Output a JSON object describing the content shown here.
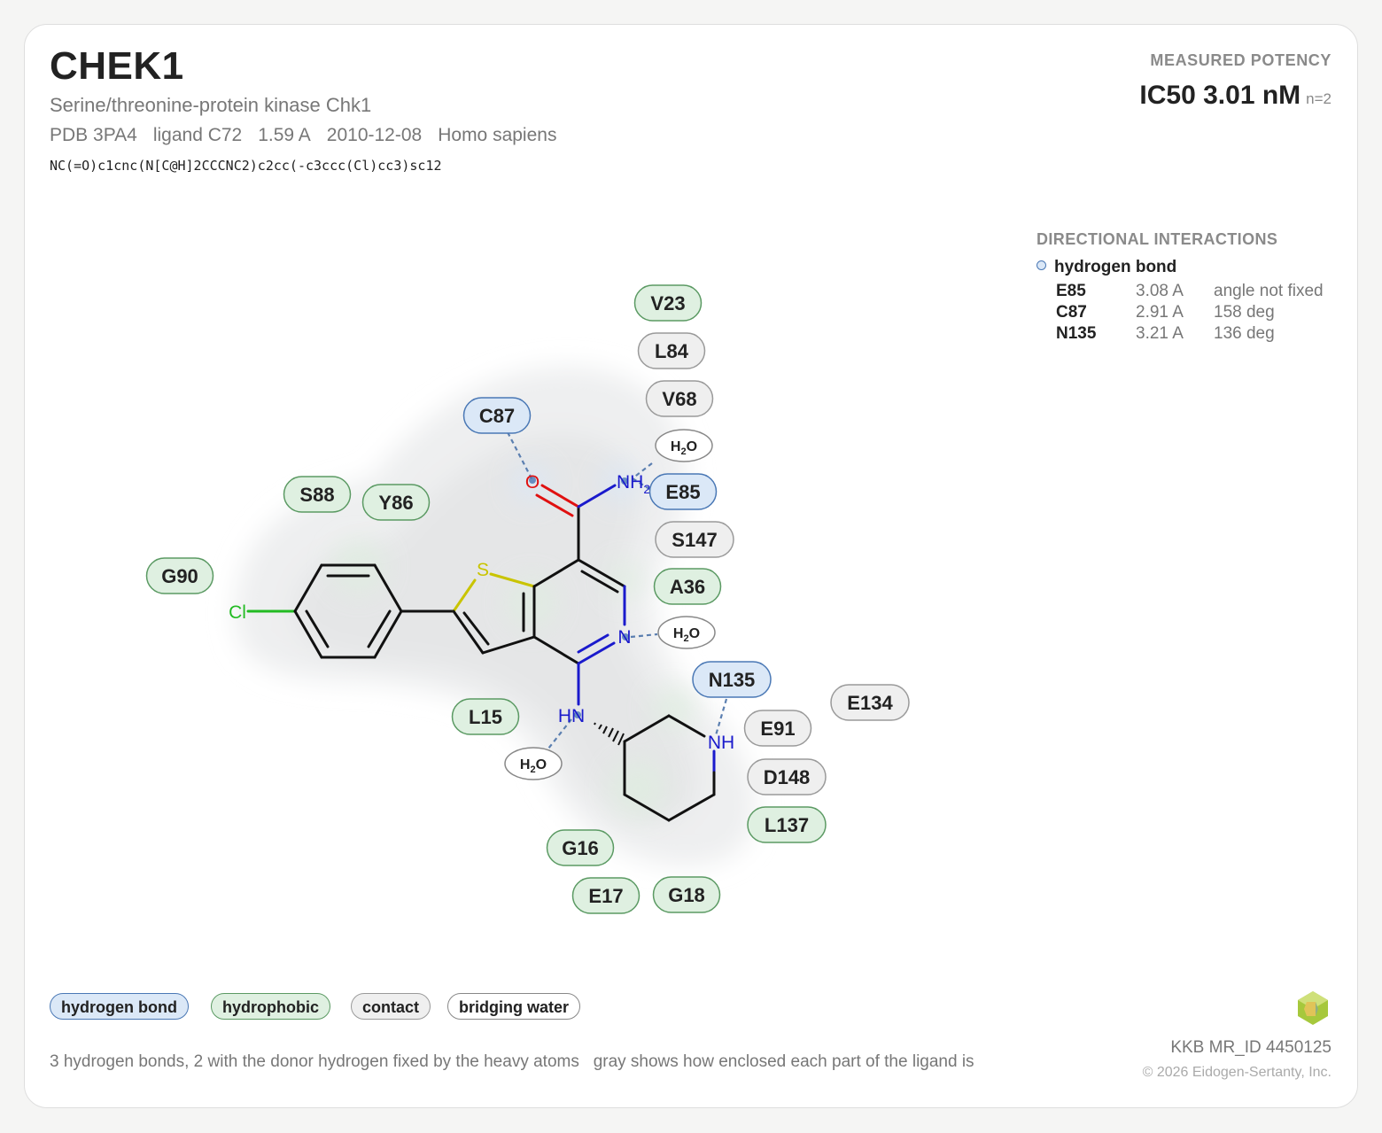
{
  "header": {
    "gene": "CHEK1",
    "protein": "Serine/threonine-protein kinase Chk1",
    "pdb": "PDB 3PA4",
    "ligand": "ligand C72",
    "resolution": "1.59 A",
    "date": "2010-12-08",
    "organism": "Homo sapiens",
    "smiles": "NC(=O)c1cnc(N[C@H]2CCCNC2)c2cc(-c3ccc(Cl)cc3)sc12"
  },
  "potency": {
    "label": "MEASURED POTENCY",
    "value": "IC50 3.01 nM",
    "n": "n=2"
  },
  "directional_interactions": {
    "title": "DIRECTIONAL INTERACTIONS",
    "type": "hydrogen bond",
    "rows": [
      {
        "residue": "E85",
        "distance": "3.08 A",
        "angle": "angle not fixed"
      },
      {
        "residue": "C87",
        "distance": "2.91 A",
        "angle": "158 deg"
      },
      {
        "residue": "N135",
        "distance": "3.21 A",
        "angle": "136 deg"
      }
    ]
  },
  "residues": [
    {
      "label": "V23",
      "kind": "hydrophobic"
    },
    {
      "label": "L84",
      "kind": "contact"
    },
    {
      "label": "V68",
      "kind": "contact"
    },
    {
      "label": "C87",
      "kind": "hbond"
    },
    {
      "label": "E85",
      "kind": "hbond"
    },
    {
      "label": "S88",
      "kind": "hydrophobic"
    },
    {
      "label": "Y86",
      "kind": "hydrophobic"
    },
    {
      "label": "G90",
      "kind": "hydrophobic"
    },
    {
      "label": "S147",
      "kind": "contact"
    },
    {
      "label": "A36",
      "kind": "hydrophobic"
    },
    {
      "label": "N135",
      "kind": "hbond"
    },
    {
      "label": "E134",
      "kind": "contact"
    },
    {
      "label": "E91",
      "kind": "contact"
    },
    {
      "label": "D148",
      "kind": "contact"
    },
    {
      "label": "L137",
      "kind": "hydrophobic"
    },
    {
      "label": "L15",
      "kind": "hydrophobic"
    },
    {
      "label": "G16",
      "kind": "hydrophobic"
    },
    {
      "label": "E17",
      "kind": "hydrophobic"
    },
    {
      "label": "G18",
      "kind": "hydrophobic"
    }
  ],
  "water_label": "H2O",
  "atoms": {
    "O": "O",
    "NH2": "NH",
    "NH2_sub": "2",
    "N": "N",
    "S": "S",
    "Cl": "Cl",
    "HN": "HN",
    "NH": "NH"
  },
  "legend": {
    "hbond": "hydrogen bond",
    "hydrophobic": "hydrophobic",
    "contact": "contact",
    "water": "bridging water"
  },
  "footer": {
    "note1": "3 hydrogen bonds, 2 with the donor hydrogen fixed by the heavy atoms",
    "note2": "gray shows how enclosed each part of the ligand is",
    "mr_id": "KKB MR_ID 4450125",
    "copyright": "© 2026 Eidogen-Sertanty, Inc."
  },
  "colors": {
    "hbond_fill": "#dbe8f7",
    "hbond_stroke": "#4a78b5",
    "hydrophobic_fill": "#dff0e1",
    "hydrophobic_stroke": "#5b9a63",
    "contact_fill": "#efefef",
    "contact_stroke": "#9a9a9a",
    "water_fill": "#ffffff",
    "water_stroke": "#888888",
    "nitrogen": "#1a1acc",
    "oxygen": "#e01010",
    "sulfur": "#c9c400",
    "chlorine": "#22bb22"
  }
}
